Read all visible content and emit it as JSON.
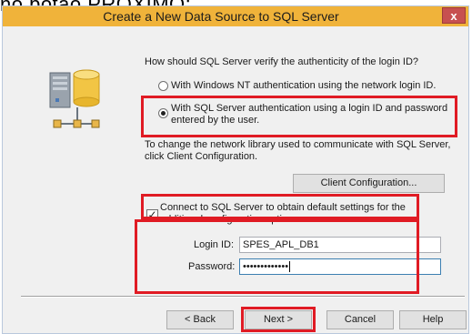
{
  "background_caption": "no botão PRÓXIMO;",
  "window": {
    "title": "Create a New Data Source to SQL Server",
    "close_glyph": "x"
  },
  "question": "How should SQL Server verify the authenticity of the login ID?",
  "auth_options": {
    "windows_nt": "With Windows NT authentication using the network login ID.",
    "sql_server_line1": "With SQL Server authentication using a login ID and password",
    "sql_server_line2": "entered by the user.",
    "selected": "sql_server"
  },
  "library_note_line1": "To change the network library used to communicate with SQL Server,",
  "library_note_line2": "click Client Configuration.",
  "client_config_button": "Client Configuration...",
  "connect_checkbox": {
    "line1": "Connect to SQL Server to obtain default settings for the",
    "line2": "additional configuration options.",
    "checked": true
  },
  "login": {
    "login_id_label": "Login ID:",
    "login_id_value": "SPES_APL_DB1",
    "password_label": "Password:",
    "password_value": "•••••••••••••"
  },
  "buttons": {
    "back": "< Back",
    "next": "Next >",
    "cancel": "Cancel",
    "help": "Help"
  },
  "highlight_color": "#e01b24",
  "title_bar_color": "#f0b33a"
}
